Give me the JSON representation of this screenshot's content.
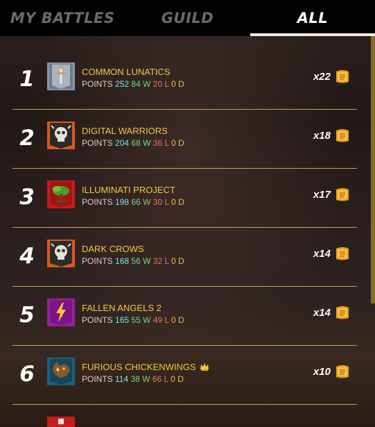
{
  "tabs": [
    {
      "label": "MY BATTLES",
      "active": false
    },
    {
      "label": "GUILD",
      "active": false
    },
    {
      "label": "ALL",
      "active": true
    }
  ],
  "stat_labels": {
    "points": "POINTS",
    "wins_suffix": "W",
    "losses_suffix": "L",
    "draws_suffix": "D"
  },
  "rows": [
    {
      "rank": "1",
      "name": "COMMON LUNATICS",
      "points": "252",
      "wins": "84",
      "losses": "20",
      "draws": "0",
      "multiplier": "x22",
      "banner_icon": "sword-banner-icon"
    },
    {
      "rank": "2",
      "name": "DIGITAL WARRIORS",
      "points": "204",
      "wins": "68",
      "losses": "36",
      "draws": "0",
      "multiplier": "x18",
      "banner_icon": "skull-banner-icon"
    },
    {
      "rank": "3",
      "name": "ILLUMINATI PROJECT",
      "points": "198",
      "wins": "66",
      "losses": "30",
      "draws": "0",
      "multiplier": "x17",
      "banner_icon": "tree-banner-icon"
    },
    {
      "rank": "4",
      "name": "DARK CROWS",
      "points": "168",
      "wins": "56",
      "losses": "32",
      "draws": "0",
      "multiplier": "x14",
      "banner_icon": "skull-banner-icon"
    },
    {
      "rank": "5",
      "name": "FALLEN ANGELS 2",
      "points": "165",
      "wins": "55",
      "losses": "49",
      "draws": "0",
      "multiplier": "x14",
      "banner_icon": "lightning-banner-icon"
    },
    {
      "rank": "6",
      "name": "FURIOUS CHICKENWINGS",
      "points": "114",
      "wins": "38",
      "losses": "66",
      "draws": "0",
      "multiplier": "x10",
      "banner_icon": "wolf-banner-icon",
      "badge_icon": "crown-icon"
    }
  ],
  "colors": {
    "name": "#f5c842",
    "points": "#7ee6e3",
    "wins": "#79d879",
    "losses": "#e6736f",
    "draws": "#e9c24a",
    "divider": "#c9a25a"
  }
}
